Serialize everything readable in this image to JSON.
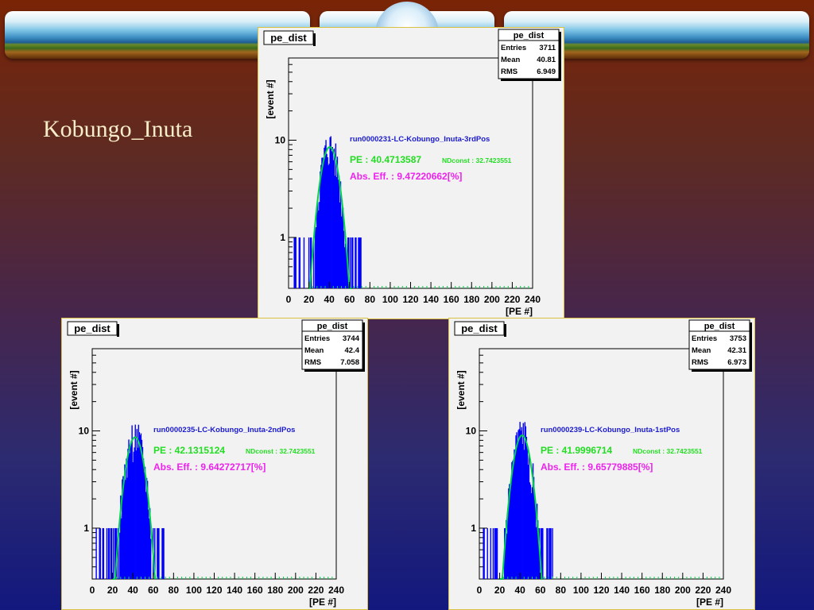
{
  "slide": {
    "title": "Kobungo_Inuta"
  },
  "colors": {
    "histogram": "#0000ff",
    "fit": "#00d24a",
    "run_label": "#1a1ad0",
    "pe_label": "#22dd22",
    "eff_label": "#ee22ee",
    "frame": "#d8c040"
  },
  "chart_data": [
    {
      "type": "bar",
      "title": "pe_dist",
      "ylabel": "[event #]",
      "xlabel": "[PE #]",
      "xlim": [
        0,
        240
      ],
      "ylog": true,
      "x_ticks": [
        0,
        20,
        40,
        60,
        80,
        100,
        120,
        140,
        160,
        180,
        200,
        220,
        240
      ],
      "y_ticks": [
        {
          "value": 1,
          "label": "1"
        },
        {
          "value": 10,
          "label": "10"
        }
      ],
      "stats": {
        "name": "pe_dist",
        "rows": [
          [
            "Entries",
            "3711"
          ],
          [
            "Mean",
            "40.81"
          ],
          [
            "RMS",
            "6.949"
          ]
        ]
      },
      "fit": {
        "mean": 40.47,
        "sigma": 7.5,
        "peak": 8.5
      },
      "annotations": {
        "run": "run0000231-LC-Kobungo_Inuta-3rdPos",
        "pe": "PE : 40.4713587",
        "ndconst": "NDconst : 32.7423551",
        "eff": "Abs. Eff. : 9.47220662[%]"
      }
    },
    {
      "type": "bar",
      "title": "pe_dist",
      "ylabel": "[event #]",
      "xlabel": "[PE #]",
      "xlim": [
        0,
        240
      ],
      "ylog": true,
      "x_ticks": [
        0,
        20,
        40,
        60,
        80,
        100,
        120,
        140,
        160,
        180,
        200,
        220,
        240
      ],
      "y_ticks": [
        {
          "value": 1,
          "label": "1"
        },
        {
          "value": 10,
          "label": "10"
        }
      ],
      "stats": {
        "name": "pe_dist",
        "rows": [
          [
            "Entries",
            "3744"
          ],
          [
            "Mean",
            "42.4"
          ],
          [
            "RMS",
            "7.058"
          ]
        ]
      },
      "fit": {
        "mean": 42.13,
        "sigma": 7.6,
        "peak": 8.6
      },
      "annotations": {
        "run": "run0000235-LC-Kobungo_Inuta-2ndPos",
        "pe": "PE : 42.1315124",
        "ndconst": "NDconst : 32.7423551",
        "eff": "Abs. Eff. : 9.64272717[%]"
      }
    },
    {
      "type": "bar",
      "title": "pe_dist",
      "ylabel": "[event #]",
      "xlabel": "[PE #]",
      "xlim": [
        0,
        240
      ],
      "ylog": true,
      "x_ticks": [
        0,
        20,
        40,
        60,
        80,
        100,
        120,
        140,
        160,
        180,
        200,
        220,
        240
      ],
      "y_ticks": [
        {
          "value": 1,
          "label": "1"
        },
        {
          "value": 10,
          "label": "10"
        }
      ],
      "stats": {
        "name": "pe_dist",
        "rows": [
          [
            "Entries",
            "3753"
          ],
          [
            "Mean",
            "42.31"
          ],
          [
            "RMS",
            "6.973"
          ]
        ]
      },
      "fit": {
        "mean": 42.0,
        "sigma": 7.4,
        "peak": 9.0
      },
      "annotations": {
        "run": "run0000239-LC-Kobungo_Inuta-1stPos",
        "pe": "PE : 41.9996714",
        "ndconst": "NDconst : 32.7423551",
        "eff": "Abs. Eff. : 9.65779885[%]"
      }
    }
  ]
}
